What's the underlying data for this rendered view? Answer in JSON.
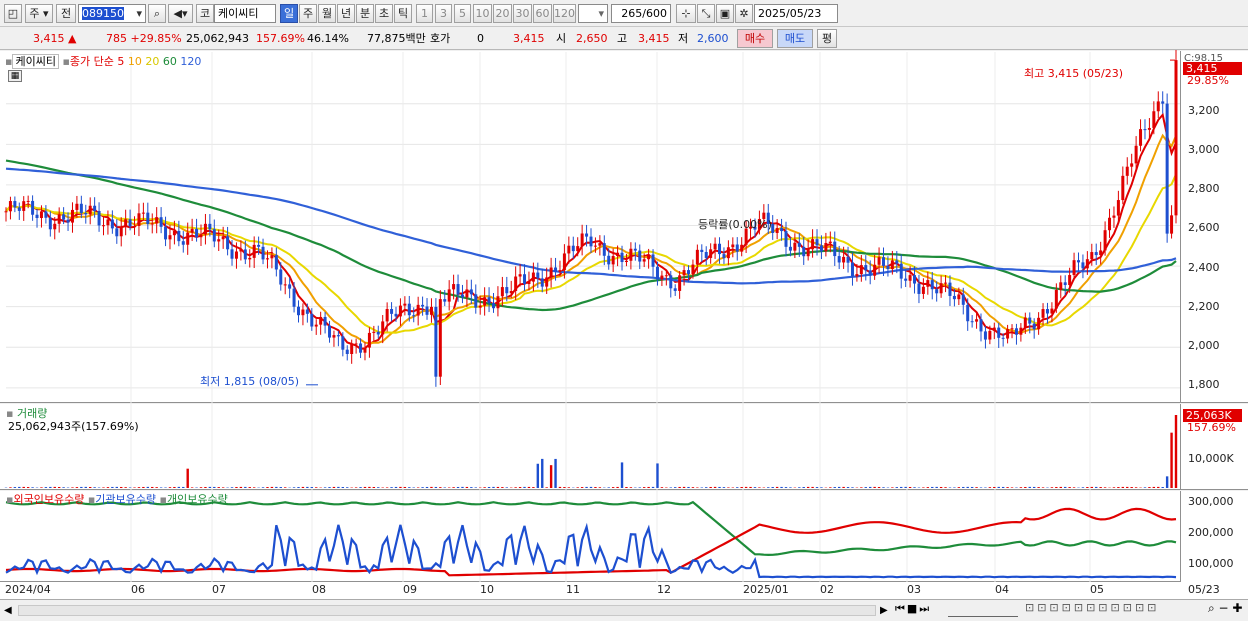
{
  "toolbar": {
    "mode_label": "주",
    "prev_label": "전",
    "code": "089150",
    "market_label": "코",
    "name": "케이씨티",
    "periods": [
      "일",
      "주",
      "월",
      "년",
      "분",
      "초",
      "틱"
    ],
    "intervals": [
      "1",
      "3",
      "5",
      "10",
      "20",
      "30",
      "60",
      "120"
    ],
    "count": "265",
    "count_max": "/600",
    "date": "2025/05/23"
  },
  "quote": {
    "price": "3,415",
    "change": "785",
    "change_rate": "+29.85%",
    "volume": "25,062,943",
    "volume_rate": "157.69%",
    "turnover_rate": "46.14%",
    "amount": "77,875백만",
    "hoga_label": "호가",
    "hoga_value": "0",
    "hoga_price": "3,415",
    "open_label": "시",
    "open": "2,650",
    "high_label": "고",
    "high": "3,415",
    "low_label": "저",
    "low": "2,600",
    "buy": "매수",
    "sell": "매도",
    "even": "평"
  },
  "legend": {
    "name": "케이씨티",
    "price_label": "종가 단순",
    "ma": [
      "5",
      "10",
      "20",
      "60",
      "120"
    ],
    "ma_colors": [
      "#e00000",
      "#f0a000",
      "#e8d800",
      "#1e8c3a",
      "#3060d8"
    ]
  },
  "annotations": {
    "high": "최고 3,415 (05/23)",
    "low": "최저 1,815 (08/05)",
    "mid": "등락률(0.00%)"
  },
  "price_axis": {
    "ticks": [
      "3,200",
      "3,000",
      "2,800",
      "2,600",
      "2,400",
      "2,200",
      "2,000",
      "1,800"
    ],
    "current": "3,415",
    "current_rate": "29.85%",
    "top": "C:98.15"
  },
  "volume": {
    "title": "거래량",
    "value": "25,062,943주(157.69%)",
    "tick": "10,000K",
    "current": "25,063K",
    "current_rate": "157.69%"
  },
  "holdings": {
    "labels": [
      "외국인보유수량",
      "기관보유수량",
      "개인보유수량"
    ],
    "colors": [
      "#e00000",
      "#1d4fd0",
      "#1e8c3a"
    ],
    "ticks": [
      "300,000",
      "200,000",
      "100,000"
    ]
  },
  "x_axis": [
    "2024/04",
    "06",
    "07",
    "08",
    "09",
    "10",
    "11",
    "12",
    "2025/01",
    "02",
    "03",
    "04",
    "05"
  ],
  "x_end": "05/23",
  "chart_data": {
    "type": "candlestick",
    "x": [
      "2024/04",
      "05",
      "06",
      "07",
      "08",
      "09",
      "10",
      "11",
      "12",
      "2025/01",
      "02",
      "03",
      "04",
      "05",
      "05/23"
    ],
    "close": [
      2670,
      2640,
      2580,
      2470,
      1980,
      2230,
      2260,
      2520,
      2340,
      2600,
      2430,
      2330,
      2020,
      2450,
      3415
    ],
    "ylim": [
      1750,
      3450
    ],
    "ma60_start": 2920,
    "ma120_start": 2880,
    "high_point": {
      "date": "05/23",
      "value": 3415
    },
    "low_point": {
      "date": "08/05",
      "value": 1815
    },
    "volume_unit": "K",
    "volume_last": 25063,
    "holdings_range": [
      0,
      300000
    ]
  }
}
